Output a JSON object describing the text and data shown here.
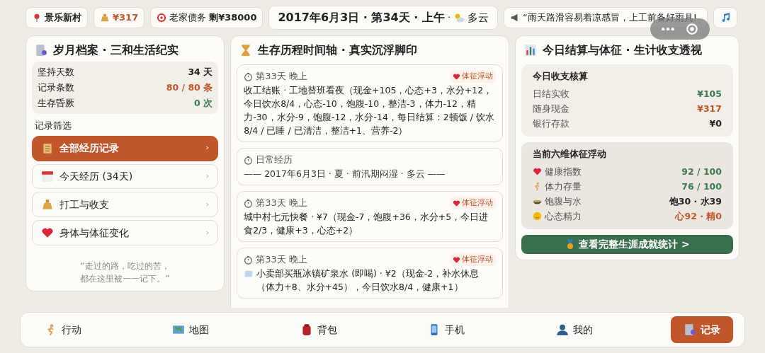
{
  "top_bar": {
    "location": "景乐新村",
    "cash": "¥317",
    "debt_label": "老家债务",
    "debt_value": "剩¥38000",
    "date": "2017年6月3日 · 第34天 · 上午",
    "weather_separator": "·",
    "weather": "多云",
    "notice": "“雨天路滑容易着凉感冒，上工前备好雨具!"
  },
  "archive": {
    "title": "岁月档案 · 三和生活纪实",
    "stats": [
      {
        "label": "坚持天数",
        "value": "34 天",
        "color": "#222222"
      },
      {
        "label": "记录条数",
        "value": "80 / 80 条",
        "color": "#c0562a"
      },
      {
        "label": "生存昏厥",
        "value": "0 次",
        "color": "#3a7a50"
      }
    ],
    "filter_label": "记录筛选",
    "filters": [
      {
        "label": "全部经历记录",
        "arrow": "›",
        "selected": true
      },
      {
        "label": "今天经历 (34天)",
        "arrow": "›",
        "selected": false
      },
      {
        "label": "打工与收支",
        "arrow": "›",
        "selected": false
      },
      {
        "label": "身体与体征变化",
        "arrow": "›",
        "selected": false
      }
    ],
    "quote_lines": [
      "“走过的路，吃过的苦，",
      "都在这里被一一记下。”"
    ]
  },
  "timeline": {
    "title": "生存历程时间轴 · 真实沉浮脚印",
    "entries": [
      {
        "kind": "event",
        "time": "第33天 晚上",
        "badge": "体征浮动",
        "text": "收工结账 · 工地替班看夜（现金+105，心态+3，水分+12，今日饮水8/4，心态-10，饱腹-10，整洁-3，体力-12，精力-30，水分-9，饱腹-12，水分-14，每日结算：2顿饭 / 饮水8/4 / 已睡 / 已清洁，整洁+1、营养-2）"
      },
      {
        "kind": "daily",
        "time": "日常经历",
        "text": "—— 2017年6月3日 · 夏 · 前汛期闷湿 · 多云 ——"
      },
      {
        "kind": "event",
        "time": "第33天 晚上",
        "badge": "体征浮动",
        "text": "城中村七元快餐 · ¥7（现金-7，饱腹+36，水分+5，今日进食2/3，健康+3，心态+2）"
      },
      {
        "kind": "event",
        "time": "第33天 晚上",
        "badge": "体征浮动",
        "text": "小卖部买瓶冰镇矿泉水 (即喝) · ¥2（现金-2，补水休息（体力+8、水分+45），今日饮水8/4，健康+1）"
      }
    ]
  },
  "summary": {
    "title": "今日结算与体征 · 生计收支透视",
    "ledger_title": "今日收支核算",
    "ledger": [
      {
        "label": "日结实收",
        "value": "¥105",
        "color": "#3a7a50"
      },
      {
        "label": "随身现金",
        "value": "¥317",
        "color": "#c0562a"
      },
      {
        "label": "银行存款",
        "value": "¥0",
        "color": "#222222"
      }
    ],
    "vitals_title": "当前六维体征浮动",
    "vitals": [
      {
        "label": "健康指数",
        "value": "92 / 100",
        "color": "#3a7a50"
      },
      {
        "label": "体力存量",
        "value": "76 / 100",
        "color": "#3a7a50"
      },
      {
        "label": "饱腹与水",
        "value": "饱30 · 水39",
        "color": "#222222"
      },
      {
        "label": "心态精力",
        "value": "心92 · 精0",
        "color": "#c0562a"
      }
    ],
    "button": "查看完整生涯成就统计 >"
  },
  "bottom_nav": [
    {
      "label": "行动",
      "selected": false
    },
    {
      "label": "地图",
      "selected": false
    },
    {
      "label": "背包",
      "selected": false
    },
    {
      "label": "手机",
      "selected": false
    },
    {
      "label": "我的",
      "selected": false
    },
    {
      "label": "记录",
      "selected": true
    }
  ]
}
